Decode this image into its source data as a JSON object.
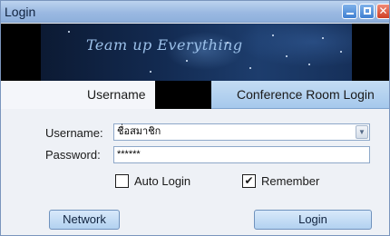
{
  "window": {
    "title": "Login"
  },
  "banner": {
    "slogan": "Team up Everything"
  },
  "tabs": [
    {
      "label": "Username",
      "active": true
    },
    {
      "label": "Conference Room Login",
      "active": false
    }
  ],
  "form": {
    "username_label": "Username:",
    "username_value": "ชื่อสมาชิก",
    "password_label": "Password:",
    "password_value": "******"
  },
  "options": {
    "auto_login_label": "Auto Login",
    "auto_login_checked": false,
    "remember_label": "Remember",
    "remember_checked": true,
    "check_mark": "✔"
  },
  "buttons": {
    "network": "Network",
    "login": "Login"
  },
  "icons": {
    "minimize": "minimize-icon",
    "maximize": "maximize-icon",
    "close": "close-icon",
    "dropdown": "chevron-down-icon"
  }
}
